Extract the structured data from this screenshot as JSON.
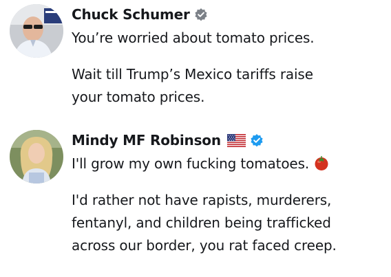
{
  "posts": [
    {
      "author": {
        "display_name": "Chuck Schumer",
        "verified_icon": "verified-badge-icon",
        "avatar_icon": "avatar-photo"
      },
      "text": {
        "lines": [
          "You’re worried about tomato prices.",
          "Wait till Trump’s Mexico tariffs raise",
          "your tomato prices."
        ]
      }
    },
    {
      "author": {
        "display_name": "Mindy MF Robinson",
        "flag_icon": "us-flag-icon",
        "verified_icon": "verified-badge-icon",
        "avatar_icon": "avatar-photo"
      },
      "text": {
        "lines": [
          "I'll grow my own fucking tomatoes.",
          "I'd rather not have rapists, murderers,",
          "fentanyl, and children being trafficked",
          "across our border, you rat faced creep."
        ],
        "emoji_icon": "tomato-icon"
      }
    }
  ],
  "colors": {
    "text": "#16181c",
    "verified_blue": "#1d9bf0",
    "background": "#ffffff"
  }
}
